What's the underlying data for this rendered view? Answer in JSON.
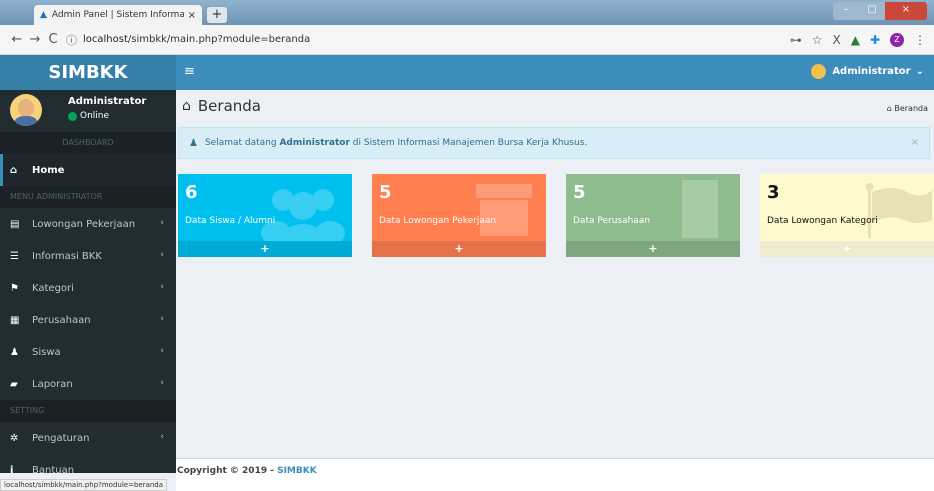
{
  "browser": {
    "tab_title": "Admin Panel | Sistem Informasi B",
    "url_host": "localhost",
    "url_path": "/simbkk/main.php?module=beranda",
    "status_url": "localhost/simbkk/main.php?module=beranda",
    "ext_badge": "Z"
  },
  "header": {
    "logo": "SIMBKK",
    "user": "Administrator"
  },
  "sidebar": {
    "user_name": "Administrator",
    "user_status": "Online",
    "section_dashboard": "DASHBOARD",
    "home_label": "Home",
    "section_menu": "MENU ADMINISTRATOR",
    "items": [
      {
        "label": "Lowongan Pekerjaan",
        "icon": "list-icon"
      },
      {
        "label": "Informasi BKK",
        "icon": "list-icon"
      },
      {
        "label": "Kategori",
        "icon": "flag-icon"
      },
      {
        "label": "Perusahaan",
        "icon": "building-icon"
      },
      {
        "label": "Siswa",
        "icon": "user-icon"
      },
      {
        "label": "Laporan",
        "icon": "report-icon"
      }
    ],
    "section_setting": "SETTING",
    "pengaturan_label": "Pengaturan",
    "bantuan_label": "Bantuan"
  },
  "content": {
    "title": "Beranda",
    "breadcrumb": "Beranda",
    "alert_prefix": "Selamat datang ",
    "alert_user": "Administrator",
    "alert_suffix": " di Sistem Informasi Manajemen Bursa Kerja Khusus.",
    "alert_close": "×"
  },
  "stats": [
    {
      "value": "6",
      "label": "Data Siswa / Alumni",
      "color": "#00c0ef"
    },
    {
      "value": "5",
      "label": "Data Lowongan Pekerjaan",
      "color": "#ff7f50"
    },
    {
      "value": "5",
      "label": "Data Perusahaan",
      "color": "#8fbc8f"
    },
    {
      "value": "3",
      "label": "Data Lowongan Kategori",
      "color": "#fffacd"
    }
  ],
  "footer": {
    "copy_prefix": "Copyright © 2019 - ",
    "brand": "SIMBKK"
  }
}
